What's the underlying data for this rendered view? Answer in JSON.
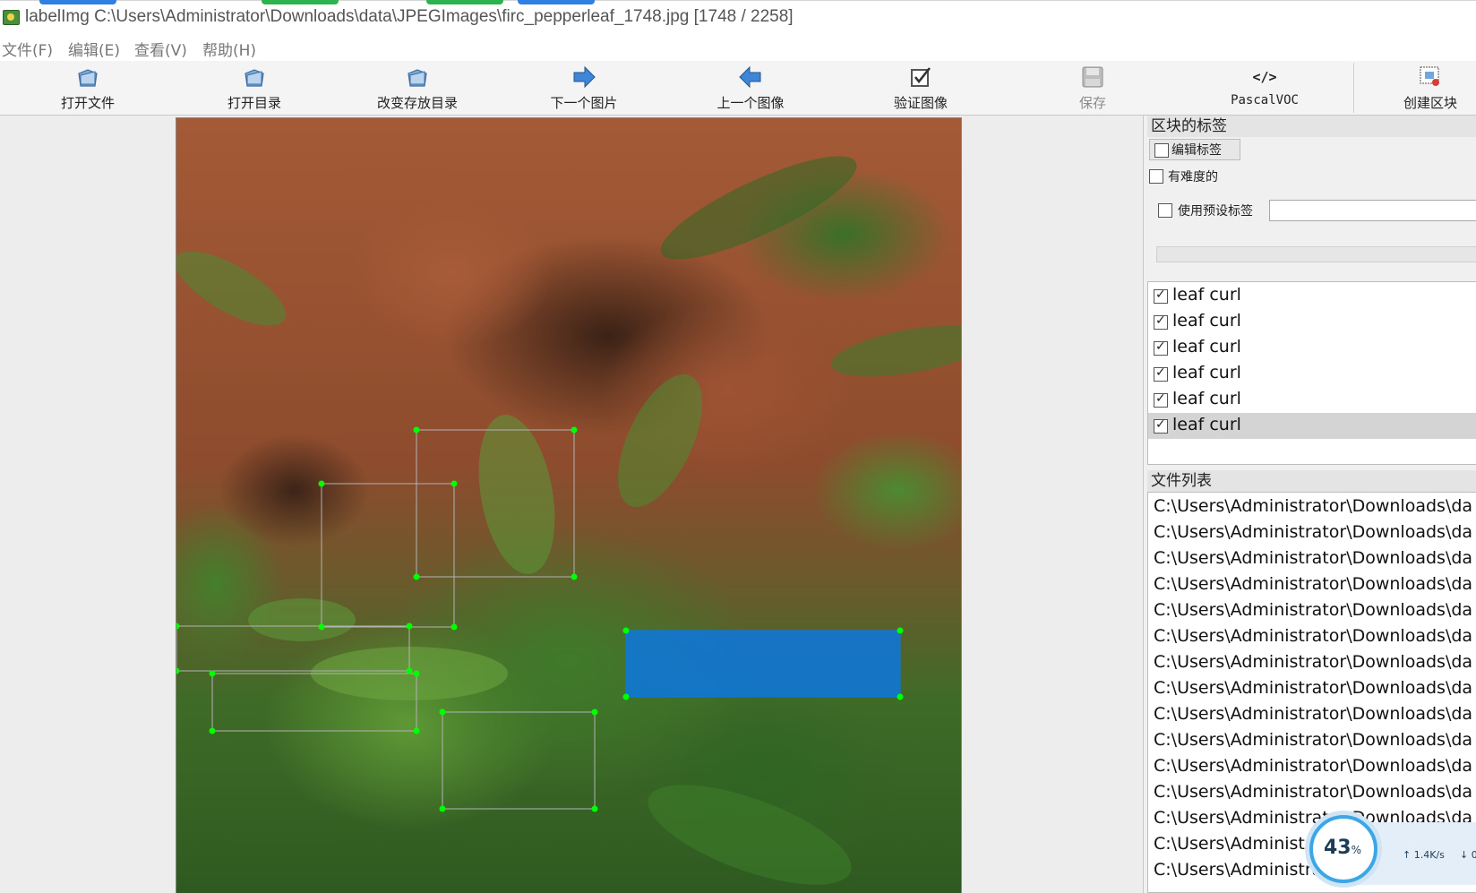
{
  "window": {
    "title": "labelImg C:\\Users\\Administrator\\Downloads\\data\\JPEGImages\\firc_pepperleaf_1748.jpg [1748 / 2258]"
  },
  "menu": {
    "items": [
      "文件(F)",
      "编辑(E)",
      "查看(V)",
      "帮助(H)"
    ]
  },
  "toolbar": {
    "open_file": "打开文件",
    "open_dir": "打开目录",
    "change_save_dir": "改变存放目录",
    "next_image": "下一个图片",
    "prev_image": "上一个图像",
    "verify_image": "验证图像",
    "save": "保存",
    "format": "PascalVOC",
    "format_icon": "</>",
    "create_box": "创建区块"
  },
  "labels_dock": {
    "title": "区块的标签",
    "edit_label_button": "编辑标签",
    "difficult_label": "有难度的",
    "difficult_checked": false,
    "use_default_label": "使用预设标签",
    "use_default_checked": false,
    "default_label_value": "",
    "items": [
      {
        "text": "leaf curl",
        "checked": true
      },
      {
        "text": "leaf curl",
        "checked": true
      },
      {
        "text": "leaf curl",
        "checked": true
      },
      {
        "text": "leaf curl",
        "checked": true
      },
      {
        "text": "leaf curl",
        "checked": true
      },
      {
        "text": "leaf curl",
        "checked": true
      }
    ],
    "selected_index": 5
  },
  "file_dock": {
    "title": "文件列表",
    "files": [
      "C:\\Users\\Administrator\\Downloads\\da",
      "C:\\Users\\Administrator\\Downloads\\da",
      "C:\\Users\\Administrator\\Downloads\\da",
      "C:\\Users\\Administrator\\Downloads\\da",
      "C:\\Users\\Administrator\\Downloads\\da",
      "C:\\Users\\Administrator\\Downloads\\da",
      "C:\\Users\\Administrator\\Downloads\\da",
      "C:\\Users\\Administrator\\Downloads\\da",
      "C:\\Users\\Administrator\\Downloads\\da",
      "C:\\Users\\Administrator\\Downloads\\da",
      "C:\\Users\\Administrator\\Downloads\\da",
      "C:\\Users\\Administrator\\Downloads\\da",
      "C:\\Users\\Administrator\\Downloads\\da",
      "C:\\Users\\Administrator\\Downloads\\da",
      "C:\\Users\\Administrator\\Downloads\\da"
    ]
  },
  "net_monitor": {
    "percent": "43",
    "percent_unit": "%",
    "upload": "1.4K/s",
    "download": "0"
  },
  "colors": {
    "box_outline": "#b3b3b3",
    "box_handle": "#00ff00",
    "selected_fill": "#0a78e6",
    "title_pills": [
      "#2f7fe4",
      "#2cb24f",
      "#2cb24f",
      "#2f7fe4"
    ]
  }
}
